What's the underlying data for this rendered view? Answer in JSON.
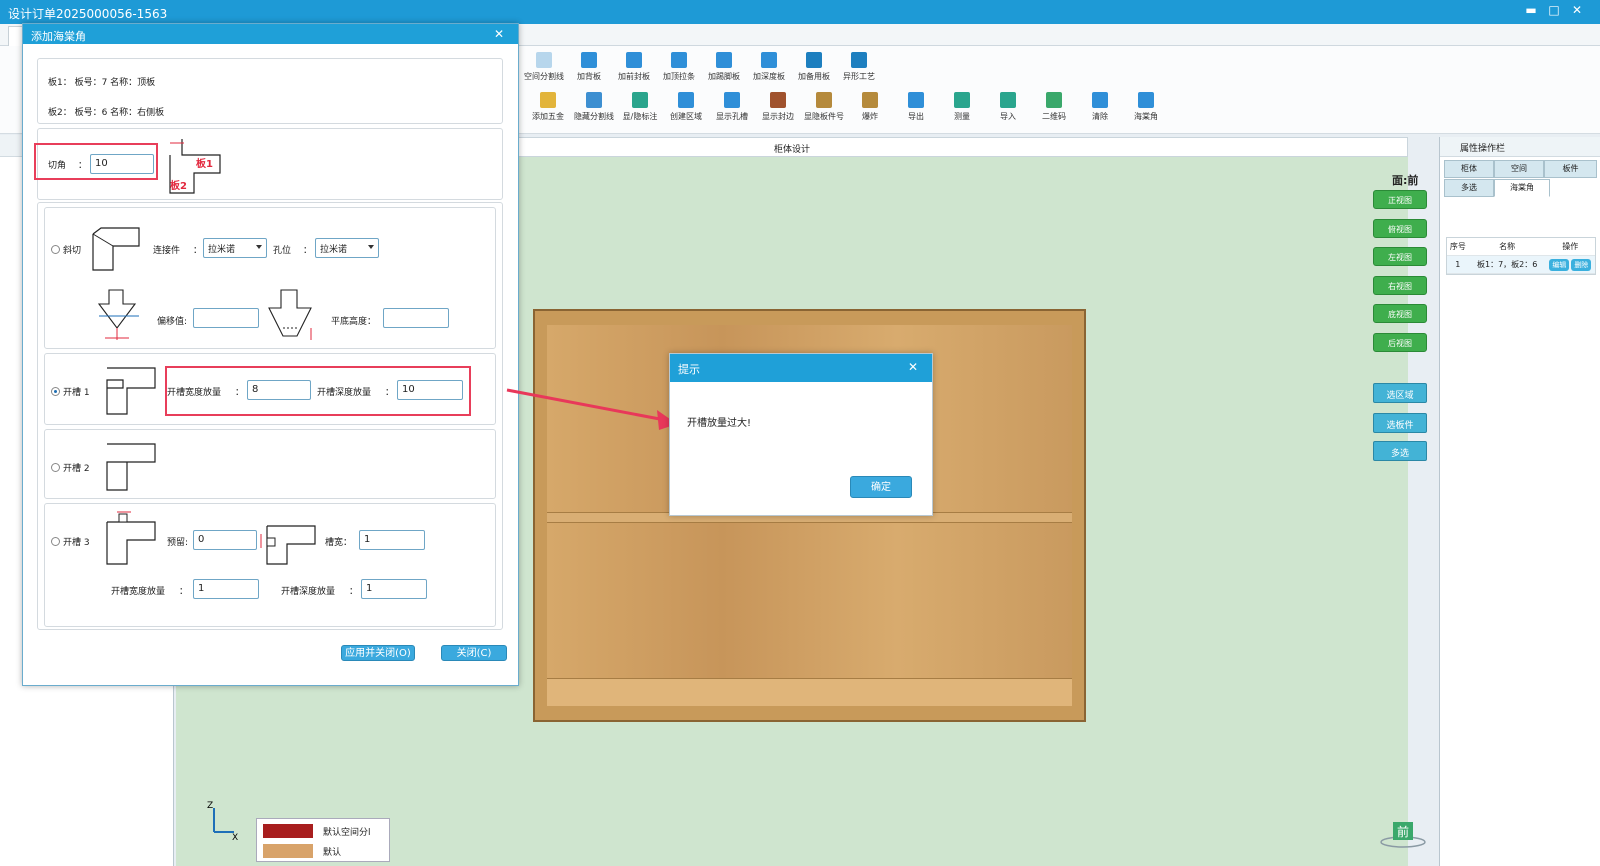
{
  "window": {
    "title": "设计订单2025000056-1563",
    "controls": [
      "▬",
      "□",
      "✕"
    ]
  },
  "ribbon": {
    "row1": [
      {
        "label": "空间分割线",
        "icon": "split-icon",
        "color": "#7fb6df",
        "dim": true
      },
      {
        "label": "加背板",
        "icon": "back-panel-icon",
        "color": "#2f8fd8"
      },
      {
        "label": "加前封板",
        "icon": "front-panel-icon",
        "color": "#2f8fd8"
      },
      {
        "label": "加顶拉条",
        "icon": "top-strip-icon",
        "color": "#2f8fd8"
      },
      {
        "label": "加踢脚板",
        "icon": "kick-board-icon",
        "color": "#2f8fd8"
      },
      {
        "label": "加深度板",
        "icon": "depth-board-icon",
        "color": "#2f8fd8"
      },
      {
        "label": "加备用板",
        "icon": "spare-board-icon",
        "color": "#1d7fbf"
      },
      {
        "label": "异形工艺",
        "icon": "shape-craft-icon",
        "color": "#1d7fbf"
      }
    ],
    "row2": [
      {
        "label": "添加五金",
        "icon": "hardware-icon",
        "color": "#e2b43b"
      },
      {
        "label": "隐藏分割线",
        "icon": "hide-split-icon",
        "color": "#3d8fd1"
      },
      {
        "label": "显/隐标注",
        "icon": "annotation-icon",
        "color": "#2aa58d"
      },
      {
        "label": "创建区域",
        "icon": "create-area-icon",
        "color": "#2f8fd8"
      },
      {
        "label": "显示孔槽",
        "icon": "hole-icon",
        "color": "#2f8fd8"
      },
      {
        "label": "显示封边",
        "icon": "edge-icon",
        "color": "#a0522d"
      },
      {
        "label": "显隐板件号",
        "icon": "board-number-icon",
        "color": "#b58a3c"
      },
      {
        "label": "爆炸",
        "icon": "explode-icon",
        "color": "#b58a3c"
      },
      {
        "label": "导出",
        "icon": "export-icon",
        "color": "#2f8fd8"
      },
      {
        "label": "测量",
        "icon": "measure-icon",
        "color": "#2aa58d"
      },
      {
        "label": "导入",
        "icon": "import-icon",
        "color": "#2aa58d"
      },
      {
        "label": "二维码",
        "icon": "qrcode-icon",
        "color": "#3aa86b"
      },
      {
        "label": "清除",
        "icon": "clear-icon",
        "color": "#2f8fd8"
      },
      {
        "label": "海棠角",
        "icon": "corner-icon",
        "color": "#2f8fd8"
      }
    ]
  },
  "canvas": {
    "header": "柜体设计",
    "view_label": "面:前",
    "view_buttons": [
      "正视图",
      "俯视图",
      "左视图",
      "右视图",
      "底视图",
      "后视图"
    ],
    "select_buttons": [
      "选区域",
      "选板件",
      "多选"
    ],
    "axis": {
      "z": "Z",
      "x": "X"
    },
    "legend": [
      {
        "label": "默认空间分l",
        "color": "#a81e1e"
      },
      {
        "label": "默认",
        "color": "#d8a36a"
      }
    ],
    "front_icon": "前"
  },
  "rightpanel": {
    "title": "属性操作栏",
    "tabs_row1": [
      "柜体",
      "空间",
      "板件"
    ],
    "tabs_row2": [
      "多选",
      "海棠角"
    ],
    "table_headers": [
      "序号",
      "名称",
      "操作"
    ],
    "rows": [
      {
        "no": "1",
        "name": "板1：7，板2：6",
        "actions": [
          "编辑",
          "删除"
        ]
      }
    ]
  },
  "dialog": {
    "title": "添加海棠角",
    "close": "✕",
    "board1": "板1：  板号：7  名称：顶板",
    "board2": "板2：  板号：6  名称：右侧板",
    "cut_corner": {
      "label": "切角",
      "colon": "：",
      "value": "10",
      "diagram_b1": "板1",
      "diagram_b2": "板2"
    },
    "bevel": {
      "label": "斜切",
      "connector_label": "连接件",
      "connector_value": "拉米诺",
      "hole_label": "孔位",
      "hole_value": "拉米诺",
      "offset_label": "偏移值:",
      "offset_value": "",
      "flat_label": "平底高度：",
      "flat_value": ""
    },
    "slot1": {
      "label": "开槽 1",
      "width_label": "开槽宽度放量",
      "width_value": "8",
      "depth_label": "开槽深度放量",
      "depth_value": "10"
    },
    "slot2": {
      "label": "开槽 2"
    },
    "slot3": {
      "label": "开槽 3",
      "reserve_label": "预留:",
      "reserve_value": "0",
      "groove_label": "槽宽：",
      "groove_value": "1",
      "width_label": "开槽宽度放量",
      "width_value": "1",
      "depth_label": "开槽深度放量",
      "depth_value": "1"
    },
    "apply_button": "应用并关闭(O)",
    "close_button": "关闭(C)"
  },
  "alert": {
    "title": "提示",
    "close": "✕",
    "message": "开槽放量过大!",
    "ok": "确定"
  }
}
